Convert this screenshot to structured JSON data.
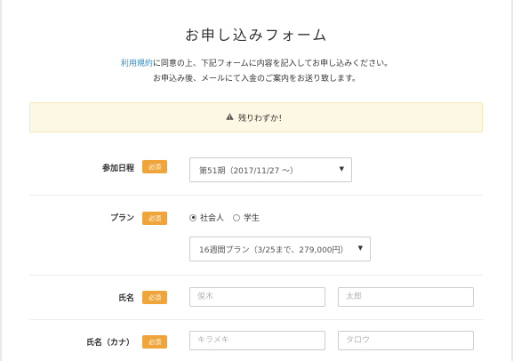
{
  "header": {
    "title": "お申し込みフォーム"
  },
  "intro": {
    "terms_link": "利用規約",
    "line1_rest": "に同意の上、下記フォームに内容を記入してお申し込みください。",
    "line2": "お申込み後、メールにて入金のご案内をお送り致します。"
  },
  "notice": {
    "icon": "warning-icon",
    "text": "残りわずか！"
  },
  "required_badge": "必須",
  "fields": {
    "schedule": {
      "label": "参加日程",
      "value": "第51期（2017/11/27 〜）"
    },
    "plan": {
      "label": "プラン",
      "options": [
        "社会人",
        "学生"
      ],
      "selected": "社会人",
      "select_value": "16週間プラン（3/25まで、279,000円）"
    },
    "name": {
      "label": "氏名",
      "last_placeholder": "俊木",
      "first_placeholder": "太郎"
    },
    "name_kana": {
      "label": "氏名（カナ）",
      "last_placeholder": "キラメキ",
      "first_placeholder": "タロウ"
    }
  },
  "colors": {
    "accent_badge": "#f0a53c",
    "link": "#3a8fc4",
    "notice_bg": "#fcf8e3"
  }
}
